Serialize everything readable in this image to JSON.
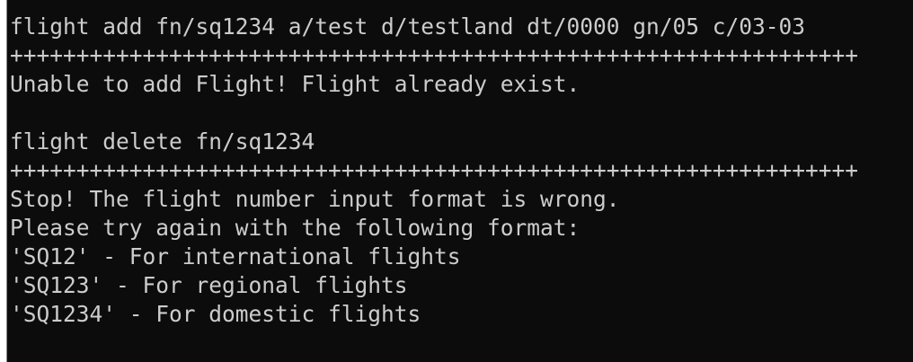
{
  "console": {
    "lines": [
      "flight add fn/sq1234 a/test d/testland dt/0000 gn/05 c/03-03",
      "++++++++++++++++++++++++++++++++++++++++++++++++++++++++++++++++",
      "Unable to add Flight! Flight already exist.",
      "",
      "flight delete fn/sq1234",
      "++++++++++++++++++++++++++++++++++++++++++++++++++++++++++++++++",
      "Stop! The flight number input format is wrong.",
      "Please try again with the following format:",
      "'SQ12' - For international flights",
      "'SQ123' - For regional flights",
      "'SQ1234' - For domestic flights"
    ],
    "colors": {
      "background": "#0c0c0c",
      "text": "#cccccc"
    }
  }
}
